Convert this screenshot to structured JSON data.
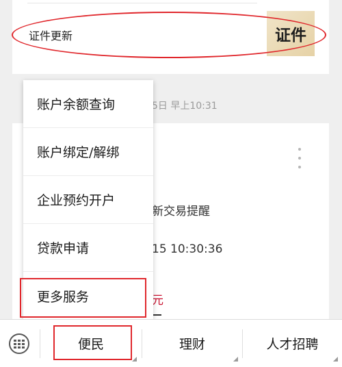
{
  "certificate_card": {
    "label": "证件更新",
    "thumbnail_text": "证件"
  },
  "message": {
    "time_fragment": "5日 早上10:31",
    "title_fragment": "新交易提醒",
    "datetime_fragment": "15 10:30:36",
    "amount_fragment": "元"
  },
  "popup_menu": {
    "items": [
      {
        "label": "账户余额查询"
      },
      {
        "label": "账户绑定/解绑"
      },
      {
        "label": "企业预约开户"
      },
      {
        "label": "贷款申请"
      },
      {
        "label": "更多服务"
      }
    ]
  },
  "bottom_bar": {
    "keyboard_icon": "keyboard-icon",
    "tabs": [
      {
        "label": "便民"
      },
      {
        "label": "理财"
      },
      {
        "label": "人才招聘"
      }
    ]
  },
  "colors": {
    "highlight_red": "#e0262b",
    "amount_red": "#c8102e"
  }
}
